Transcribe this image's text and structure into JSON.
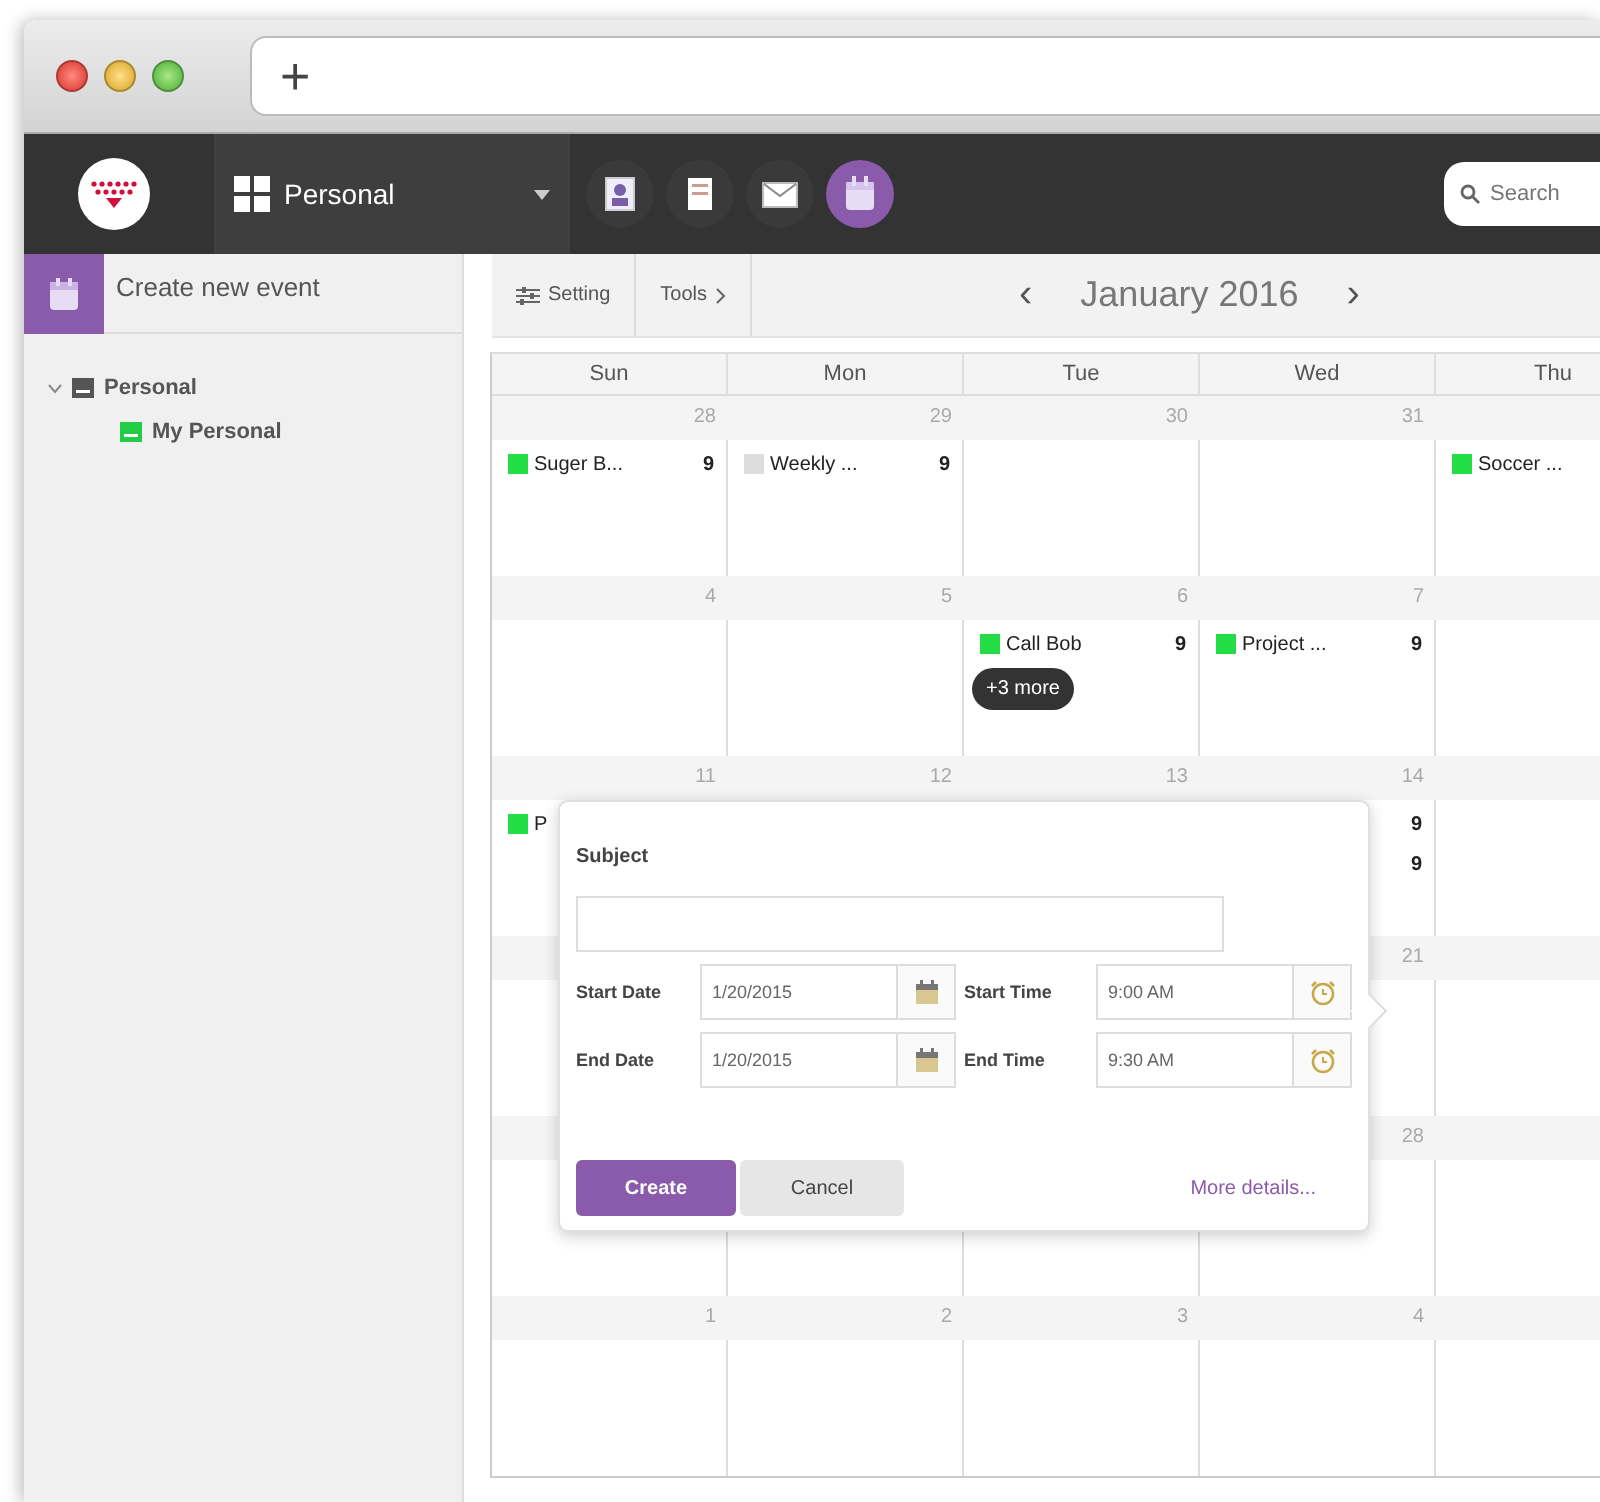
{
  "browser": {
    "new_tab": "+"
  },
  "app_bar": {
    "workspace": "Personal",
    "apps": [
      {
        "kind": "contacts",
        "selected": false
      },
      {
        "kind": "notes",
        "selected": false
      },
      {
        "kind": "mail",
        "selected": false
      },
      {
        "kind": "calendar",
        "selected": true
      }
    ],
    "search": {
      "placeholder": "Search"
    }
  },
  "sidebar": {
    "create_button": "Create new event",
    "tree": [
      {
        "label": "Personal",
        "expanded": true,
        "color": "#555555",
        "children": [
          {
            "label": "My Personal",
            "color": "#22cc44"
          }
        ]
      }
    ]
  },
  "toolbar": {
    "setting": "Setting",
    "tools": "Tools",
    "prev": "‹",
    "month": "January 2016",
    "next": "›"
  },
  "calendar": {
    "weekdays": [
      "Sun",
      "Mon",
      "Tue",
      "Wed",
      "Thu"
    ],
    "weeks": [
      {
        "days": [
          {
            "date": "28",
            "events": [
              {
                "title": "Suger B...",
                "time": "9",
                "color": "#22dd44"
              }
            ]
          },
          {
            "date": "29",
            "events": [
              {
                "title": "Weekly ...",
                "time": "9",
                "color": "#dddddd"
              }
            ]
          },
          {
            "date": "30"
          },
          {
            "date": "31"
          },
          {
            "events": [
              {
                "title": "Soccer ...",
                "color": "#22dd44"
              }
            ]
          }
        ]
      },
      {
        "days": [
          {
            "date": "4"
          },
          {
            "date": "5"
          },
          {
            "date": "6",
            "events": [
              {
                "title": "Call Bob",
                "time": "9",
                "color": "#22dd44"
              }
            ],
            "more": "+3 more"
          },
          {
            "date": "7",
            "events": [
              {
                "title": "Project ...",
                "time": "9",
                "color": "#22dd44"
              }
            ]
          }
        ]
      },
      {
        "days": [
          {
            "date": "11",
            "events": [
              {
                "title": "P",
                "color": "#22dd44"
              }
            ]
          },
          {
            "date": "12"
          },
          {
            "date": "13"
          },
          {
            "date": "14",
            "events": [
              {
                "time": "9"
              },
              {
                "time": "9"
              }
            ]
          }
        ]
      },
      {
        "days": [
          {
            "date": "21"
          }
        ]
      },
      {
        "days": [
          {
            "date": "28"
          }
        ]
      },
      {
        "days": [
          {
            "date": "1"
          },
          {
            "date": "2"
          },
          {
            "date": "3"
          },
          {
            "date": "4"
          }
        ]
      }
    ]
  },
  "new_event_popup": {
    "subject_label": "Subject",
    "rows": [
      {
        "date_label": "Start Date",
        "date": "1/20/2015",
        "time_label": "Start Time",
        "time": "9:00 AM"
      },
      {
        "date_label": "End Date",
        "date": "1/20/2015",
        "time_label": "End Time",
        "time": "9:30 AM"
      }
    ],
    "create": "Create",
    "cancel": "Cancel",
    "more_details": "More details..."
  }
}
